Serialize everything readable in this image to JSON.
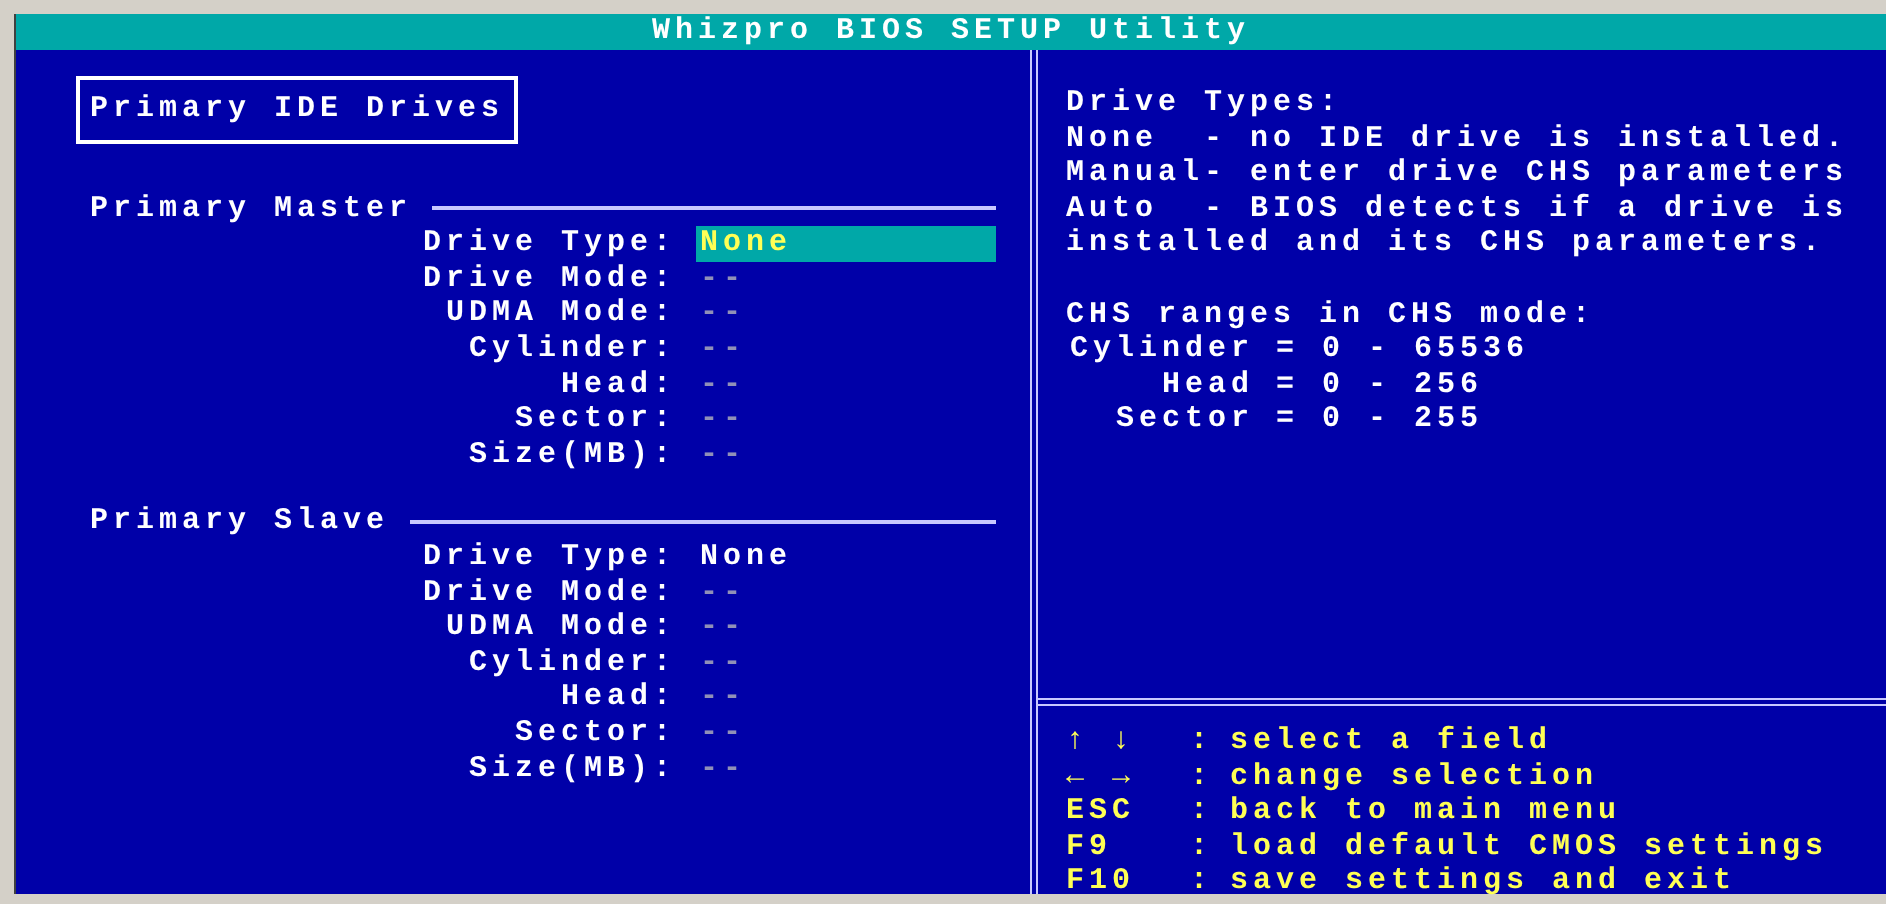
{
  "window": {
    "title": "Whizpro BIOS SETUP Utility"
  },
  "left_panel": {
    "heading": "Primary IDE Drives",
    "sections": [
      {
        "title": "Primary Master",
        "fields": [
          {
            "label": "Drive Type:",
            "value": "None",
            "selected": true,
            "disabled": false
          },
          {
            "label": "Drive Mode:",
            "value": "--",
            "selected": false,
            "disabled": true
          },
          {
            "label": "UDMA Mode:",
            "value": "--",
            "selected": false,
            "disabled": true
          },
          {
            "label": "Cylinder:",
            "value": "--",
            "selected": false,
            "disabled": true
          },
          {
            "label": "Head:",
            "value": "--",
            "selected": false,
            "disabled": true
          },
          {
            "label": "Sector:",
            "value": "--",
            "selected": false,
            "disabled": true
          },
          {
            "label": "Size(MB):",
            "value": "--",
            "selected": false,
            "disabled": true
          }
        ]
      },
      {
        "title": "Primary Slave",
        "fields": [
          {
            "label": "Drive Type:",
            "value": "None",
            "selected": false,
            "disabled": false
          },
          {
            "label": "Drive Mode:",
            "value": "--",
            "selected": false,
            "disabled": true
          },
          {
            "label": "UDMA Mode:",
            "value": "--",
            "selected": false,
            "disabled": true
          },
          {
            "label": "Cylinder:",
            "value": "--",
            "selected": false,
            "disabled": true
          },
          {
            "label": "Head:",
            "value": "--",
            "selected": false,
            "disabled": true
          },
          {
            "label": "Sector:",
            "value": "--",
            "selected": false,
            "disabled": true
          },
          {
            "label": "Size(MB):",
            "value": "--",
            "selected": false,
            "disabled": true
          }
        ]
      }
    ]
  },
  "help": {
    "lines": [
      "Drive Types:",
      "None  - no IDE drive is installed.",
      "Manual- enter drive CHS parameters",
      "Auto  - BIOS detects if a drive is",
      "installed and its CHS parameters."
    ],
    "ranges_title": "CHS ranges in CHS mode:",
    "ranges": [
      {
        "name": "Cylinder",
        "range": "= 0 - 65536"
      },
      {
        "name": "Head",
        "range": "= 0 - 256"
      },
      {
        "name": "Sector",
        "range": "= 0 - 255"
      }
    ]
  },
  "keys": [
    {
      "key": "↑ ↓",
      "colon": ":",
      "action": "select a field"
    },
    {
      "key": "← →",
      "colon": ":",
      "action": "change selection"
    },
    {
      "key": "ESC",
      "colon": ":",
      "action": "back to main menu"
    },
    {
      "key": "F9",
      "colon": ":",
      "action": "load default CMOS settings"
    },
    {
      "key": "F10",
      "colon": ":",
      "action": "save settings and exit"
    }
  ]
}
